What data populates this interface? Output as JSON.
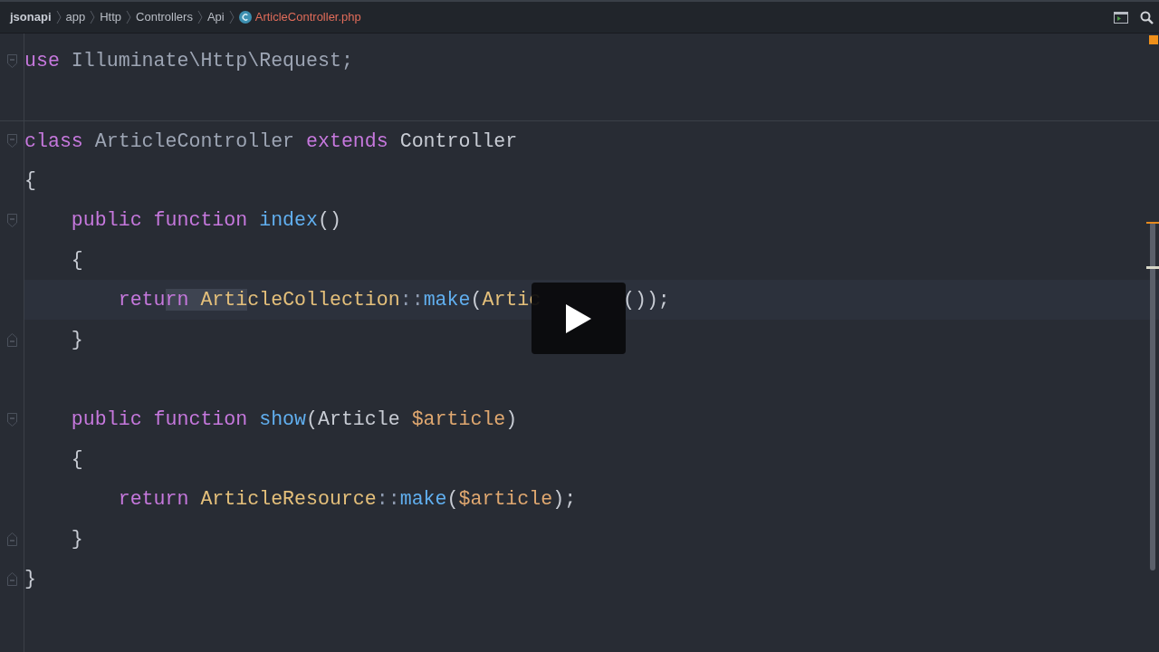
{
  "breadcrumb": [
    {
      "label": "jsonapi",
      "kind": "root"
    },
    {
      "label": "app",
      "kind": "folder"
    },
    {
      "label": "Http",
      "kind": "folder"
    },
    {
      "label": "Controllers",
      "kind": "folder"
    },
    {
      "label": "Api",
      "kind": "folder"
    },
    {
      "label": "ArticleController.php",
      "kind": "file"
    }
  ],
  "editor": {
    "lines": [
      {
        "kind": "code",
        "fold_start": true,
        "tokens": [
          {
            "text": "use",
            "kind": "keyword"
          },
          {
            "text": " Illuminate\\Http\\Request;",
            "kind": "dim"
          }
        ]
      },
      {
        "kind": "blank"
      },
      {
        "kind": "code",
        "fold_start": true,
        "separator_above": true,
        "tokens": [
          {
            "text": "class",
            "kind": "keyword"
          },
          {
            "text": " ArticleController ",
            "kind": "dim"
          },
          {
            "text": "extends",
            "kind": "keyword"
          },
          {
            "text": " Controller",
            "kind": "plain"
          }
        ]
      },
      {
        "kind": "code",
        "tokens": [
          {
            "text": "{",
            "kind": "plain"
          }
        ]
      },
      {
        "kind": "code",
        "fold_start": true,
        "tokens": [
          {
            "text": "    public function",
            "kind": "keyword"
          },
          {
            "text": " index",
            "kind": "func"
          },
          {
            "text": "()",
            "kind": "plain"
          }
        ]
      },
      {
        "kind": "code",
        "tokens": [
          {
            "text": "    {",
            "kind": "plain"
          }
        ]
      },
      {
        "kind": "code",
        "current": true,
        "tokens": [
          {
            "text": "        retu",
            "kind": "keyword"
          },
          {
            "text": "rn ",
            "kind": "keyword",
            "selected": true
          },
          {
            "text": "Arti",
            "kind": "class",
            "selected": true
          },
          {
            "text": "cleCollection",
            "kind": "class"
          },
          {
            "text": "::",
            "kind": "op"
          },
          {
            "text": "make",
            "kind": "func"
          },
          {
            "text": "(",
            "kind": "plain"
          },
          {
            "text": "Artic",
            "kind": "class"
          },
          {
            "text": "       ());",
            "kind": "plain"
          }
        ]
      },
      {
        "kind": "code",
        "fold_end": true,
        "tokens": [
          {
            "text": "    }",
            "kind": "plain"
          }
        ]
      },
      {
        "kind": "blank"
      },
      {
        "kind": "code",
        "fold_start": true,
        "tokens": [
          {
            "text": "    public function",
            "kind": "keyword"
          },
          {
            "text": " show",
            "kind": "func"
          },
          {
            "text": "(Article ",
            "kind": "plain"
          },
          {
            "text": "$article",
            "kind": "var"
          },
          {
            "text": ")",
            "kind": "plain"
          }
        ]
      },
      {
        "kind": "code",
        "tokens": [
          {
            "text": "    {",
            "kind": "plain"
          }
        ]
      },
      {
        "kind": "code",
        "tokens": [
          {
            "text": "        return",
            "kind": "keyword"
          },
          {
            "text": " ArticleResource",
            "kind": "class"
          },
          {
            "text": "::",
            "kind": "op"
          },
          {
            "text": "make",
            "kind": "func"
          },
          {
            "text": "(",
            "kind": "plain"
          },
          {
            "text": "$article",
            "kind": "var"
          },
          {
            "text": ");",
            "kind": "plain"
          }
        ]
      },
      {
        "kind": "code",
        "fold_end": true,
        "tokens": [
          {
            "text": "    }",
            "kind": "plain"
          }
        ]
      },
      {
        "kind": "code",
        "fold_end": true,
        "tokens": [
          {
            "text": "}",
            "kind": "plain"
          }
        ]
      }
    ]
  },
  "player": {
    "kind": "play"
  }
}
